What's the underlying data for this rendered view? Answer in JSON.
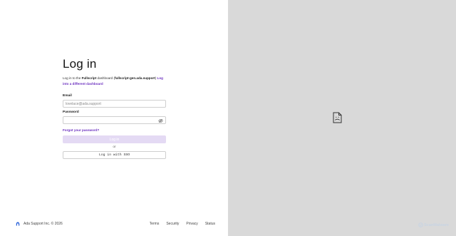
{
  "login": {
    "title": "Log in",
    "subtitle_prefix": "Log in to the ",
    "subtitle_brand": "Fullscript",
    "subtitle_mid": " dashboard (",
    "subtitle_domain": "fullscript-gen.ada.support",
    "subtitle_close": ") ",
    "subtitle_link": "Log into a different dashboard",
    "email_label": "Email",
    "email_placeholder": "lovelace@ada.support",
    "password_label": "Password",
    "password_value": "",
    "forgot_label": "Forgot your password?",
    "login_button": "Log in",
    "or_text": "or",
    "sso_button": "Log in with SSO"
  },
  "footer": {
    "copyright": "Ada Support Inc. © 2026",
    "links": [
      "Terms",
      "Security",
      "Privacy",
      "Status"
    ]
  },
  "preview": {
    "icon": "document-placeholder-icon"
  },
  "watermark": {
    "text": "ScanMalware"
  },
  "colors": {
    "accent": "#6b2fbf",
    "login_button_disabled": "#e4daf4",
    "right_panel_bg": "#d9d9d9"
  }
}
